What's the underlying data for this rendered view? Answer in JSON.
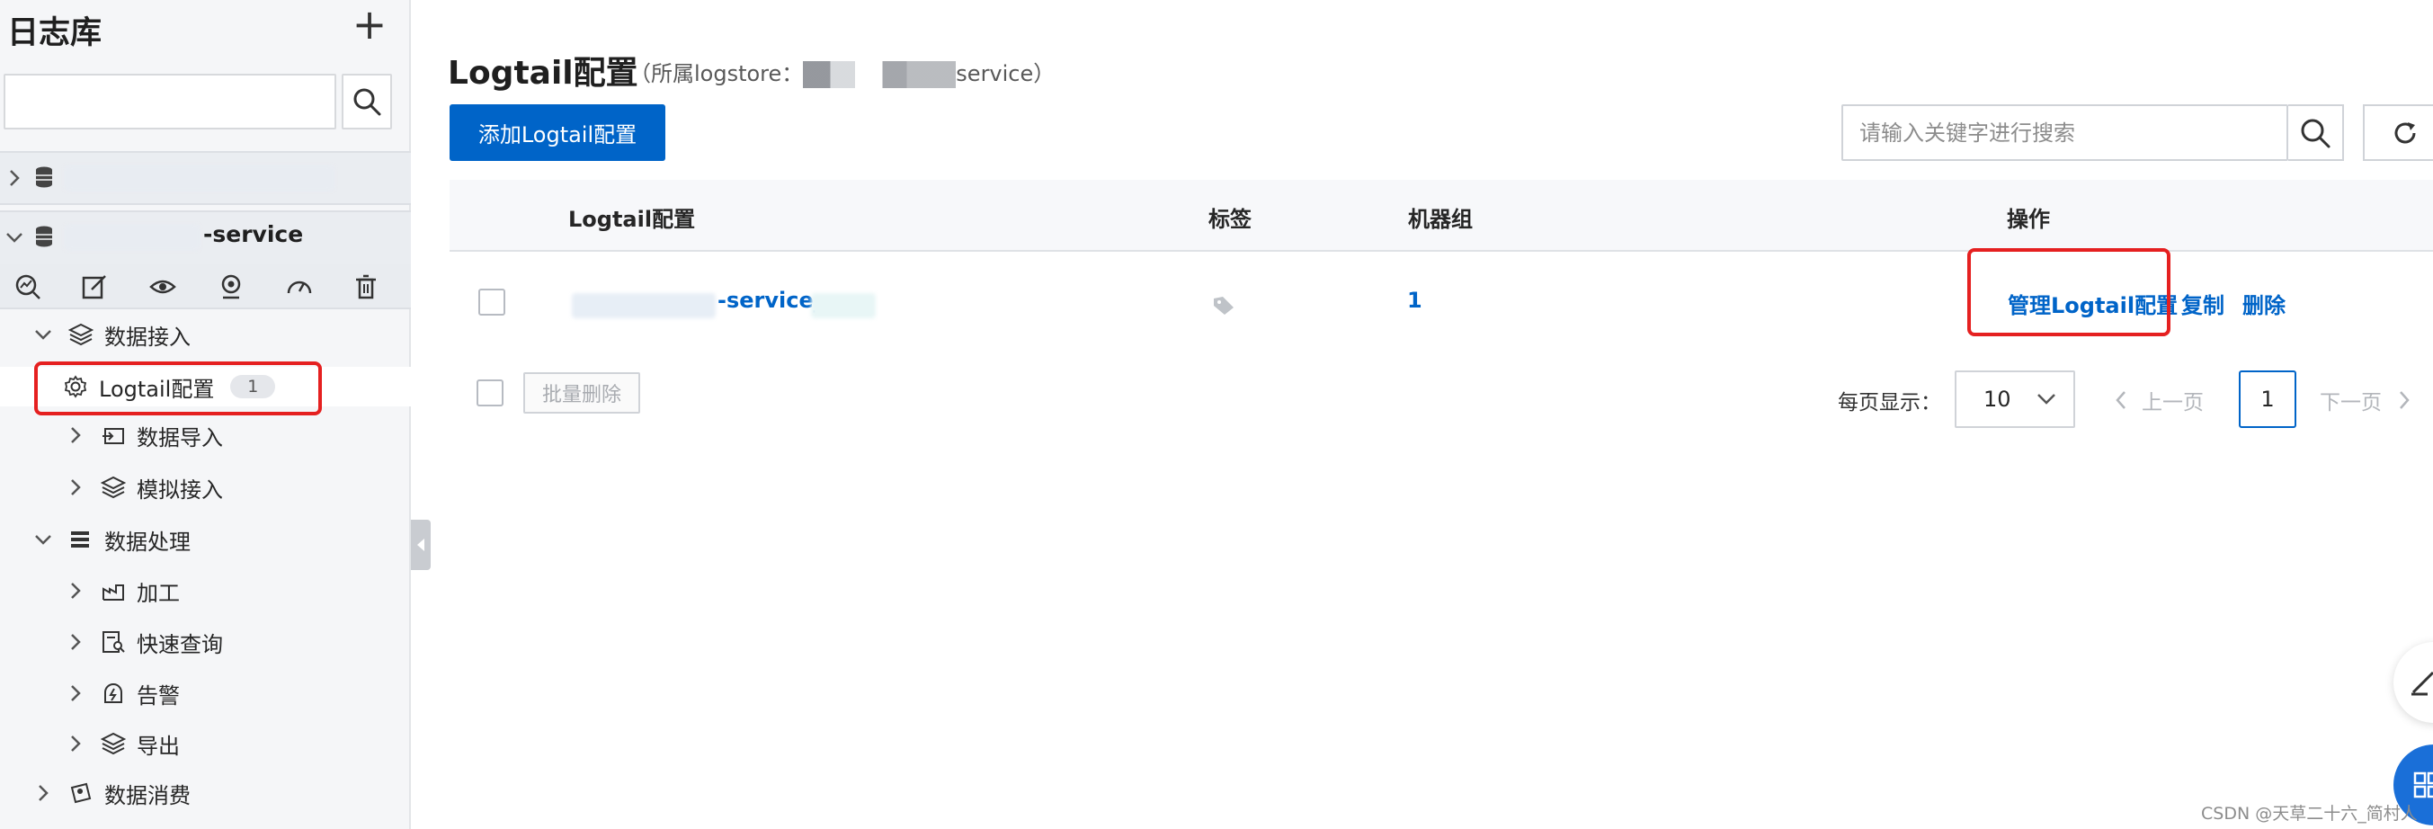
{
  "sidebar": {
    "title": "日志库",
    "search_placeholder": "",
    "selected_logstore_suffix": "-service",
    "tree": {
      "data_ingest": "数据接入",
      "logtail_config": "Logtail配置",
      "logtail_count": "1",
      "data_import": "数据导入",
      "mock_ingest": "模拟接入",
      "data_process": "数据处理",
      "transform": "加工",
      "quick_query": "快速查询",
      "alert": "告警",
      "export": "导出",
      "data_consume": "数据消费"
    }
  },
  "main": {
    "title": "Logtail配置",
    "subtitle_prefix": "（所属logstore：",
    "subtitle_suffix": "service）",
    "add_button": "添加Logtail配置",
    "search_placeholder": "请输入关键字进行搜索",
    "table": {
      "columns": [
        "Logtail配置",
        "标签",
        "机器组",
        "操作"
      ],
      "rows": [
        {
          "name_suffix": "-service_",
          "machine_group": "1",
          "actions": [
            "管理Logtail配置",
            "复制",
            "删除"
          ]
        }
      ]
    },
    "batch_delete": "批量删除",
    "pagination": {
      "per_page_label": "每页显示：",
      "page_size": "10",
      "prev": "上一页",
      "current": "1",
      "next": "下一页"
    }
  },
  "watermark": "CSDN @天草二十六_简村人",
  "colors": {
    "primary": "#0064c8",
    "highlight_box": "#e52020",
    "sidebar_bg": "#f5f6f8"
  }
}
